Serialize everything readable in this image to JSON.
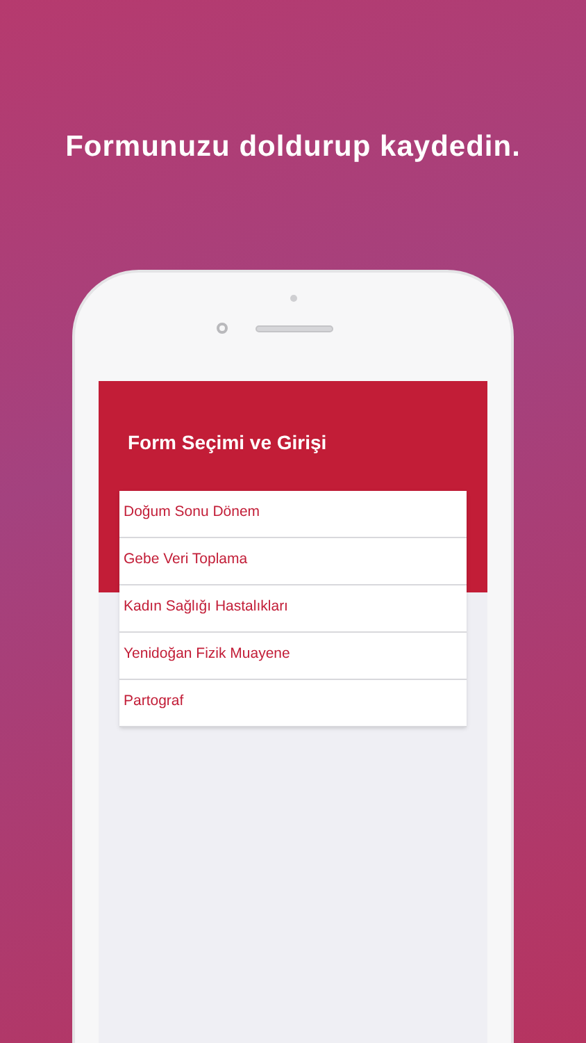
{
  "headline": "Formunuzu doldurup kaydedin.",
  "screen": {
    "title": "Form Seçimi ve Girişi",
    "forms": [
      {
        "label": "Doğum Sonu Dönem"
      },
      {
        "label": "Gebe Veri Toplama"
      },
      {
        "label": "Kadın Sağlığı Hastalıkları"
      },
      {
        "label": "Yenidoğan Fizik Muayene"
      },
      {
        "label": "Partograf"
      }
    ]
  }
}
